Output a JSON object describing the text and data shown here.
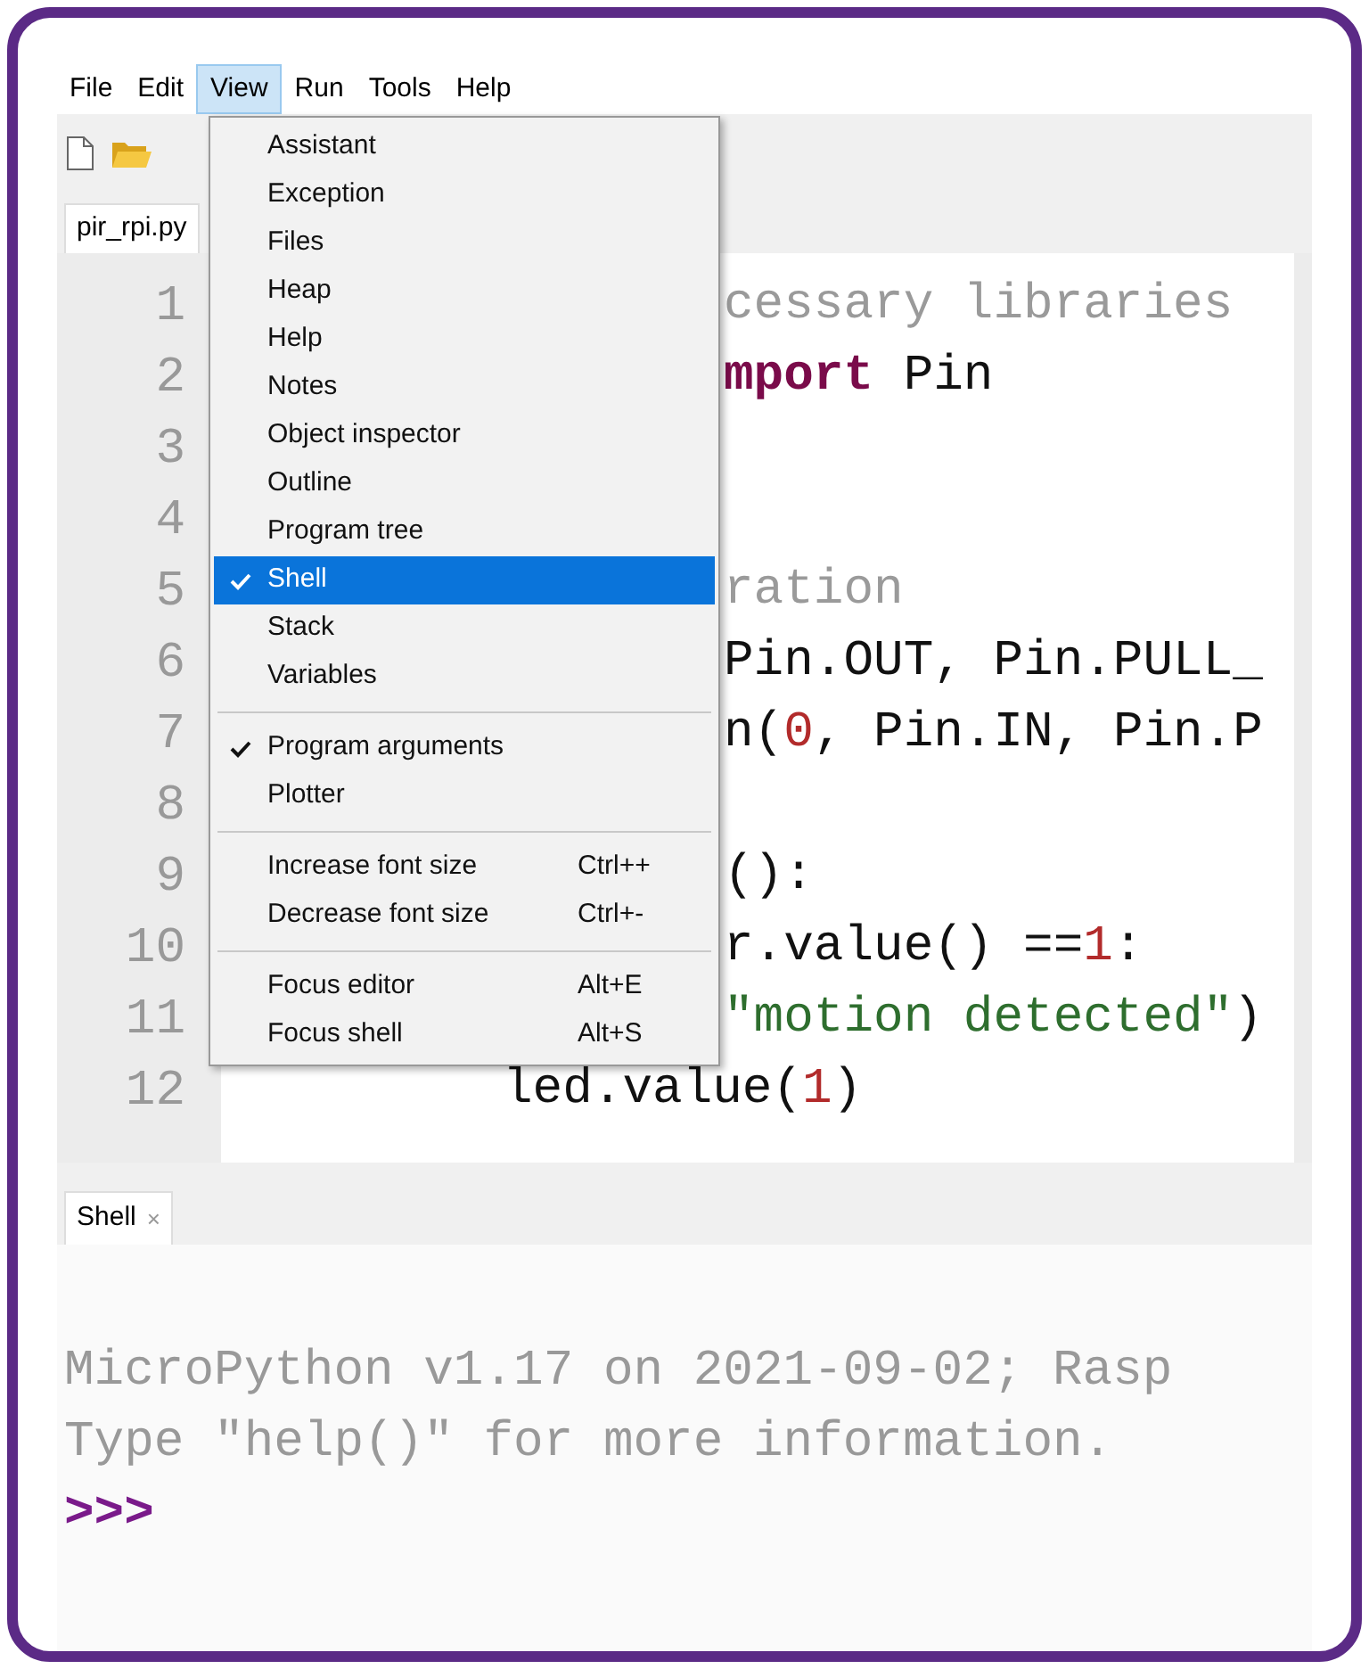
{
  "menubar": [
    {
      "label": "File",
      "selected": false
    },
    {
      "label": "Edit",
      "selected": false
    },
    {
      "label": "View",
      "selected": true
    },
    {
      "label": "Run",
      "selected": false
    },
    {
      "label": "Tools",
      "selected": false
    },
    {
      "label": "Help",
      "selected": false
    }
  ],
  "editor_tab": {
    "label": "pir_rpi.py"
  },
  "view_menu": [
    {
      "kind": "item",
      "label": "Assistant",
      "checked": false,
      "selected": false
    },
    {
      "kind": "item",
      "label": "Exception",
      "checked": false,
      "selected": false
    },
    {
      "kind": "item",
      "label": "Files",
      "checked": false,
      "selected": false
    },
    {
      "kind": "item",
      "label": "Heap",
      "checked": false,
      "selected": false
    },
    {
      "kind": "item",
      "label": "Help",
      "checked": false,
      "selected": false
    },
    {
      "kind": "item",
      "label": "Notes",
      "checked": false,
      "selected": false
    },
    {
      "kind": "item",
      "label": "Object inspector",
      "checked": false,
      "selected": false
    },
    {
      "kind": "item",
      "label": "Outline",
      "checked": false,
      "selected": false
    },
    {
      "kind": "item",
      "label": "Program tree",
      "checked": false,
      "selected": false
    },
    {
      "kind": "item",
      "label": "Shell",
      "checked": true,
      "selected": true
    },
    {
      "kind": "item",
      "label": "Stack",
      "checked": false,
      "selected": false
    },
    {
      "kind": "item",
      "label": "Variables",
      "checked": false,
      "selected": false
    },
    {
      "kind": "separator"
    },
    {
      "kind": "item",
      "label": "Program arguments",
      "checked": true,
      "selected": false
    },
    {
      "kind": "item",
      "label": "Plotter",
      "checked": false,
      "selected": false
    },
    {
      "kind": "separator"
    },
    {
      "kind": "item",
      "label": "Increase font size",
      "shortcut": "Ctrl++",
      "checked": false,
      "selected": false
    },
    {
      "kind": "item",
      "label": "Decrease font size",
      "shortcut": "Ctrl+-",
      "checked": false,
      "selected": false
    },
    {
      "kind": "separator"
    },
    {
      "kind": "item",
      "label": "Focus editor",
      "shortcut": "Alt+E",
      "checked": false,
      "selected": false
    },
    {
      "kind": "item",
      "label": "Focus shell",
      "shortcut": "Alt+S",
      "checked": false,
      "selected": false
    }
  ],
  "code_lines": [
    {
      "number": "1",
      "kind": "partial",
      "segments": [
        {
          "kind": "comment",
          "text": "cessary libraries"
        }
      ]
    },
    {
      "number": "2",
      "kind": "partial",
      "segments": [
        {
          "kind": "keyword",
          "text": "mport"
        },
        {
          "kind": "plain",
          "text": " Pin"
        }
      ]
    },
    {
      "number": "3",
      "kind": "partial"
    },
    {
      "number": "4",
      "kind": "partial"
    },
    {
      "number": "5",
      "kind": "partial",
      "segments": [
        {
          "kind": "comment",
          "text": "ration"
        }
      ]
    },
    {
      "number": "6",
      "kind": "partial",
      "segments": [
        {
          "kind": "plain",
          "text": "Pin.OUT, Pin.PULL_"
        }
      ]
    },
    {
      "number": "7",
      "kind": "partial",
      "segments": [
        {
          "kind": "plain",
          "text": "n("
        },
        {
          "kind": "number",
          "text": "0"
        },
        {
          "kind": "plain",
          "text": ", Pin.IN, Pin.P"
        }
      ]
    },
    {
      "number": "8",
      "kind": "partial"
    },
    {
      "number": "9",
      "kind": "partial",
      "segments": [
        {
          "kind": "plain",
          "text": "():"
        }
      ]
    },
    {
      "number": "10",
      "kind": "partial",
      "segments": [
        {
          "kind": "plain",
          "text": "r.value() =="
        },
        {
          "kind": "number",
          "text": "1"
        },
        {
          "kind": "plain",
          "text": ":"
        }
      ]
    },
    {
      "number": "11",
      "kind": "partial",
      "segments": [
        {
          "kind": "string",
          "text": "\"motion detected\""
        },
        {
          "kind": "plain",
          "text": ")"
        }
      ]
    },
    {
      "number": "12",
      "kind": "indented",
      "segments": [
        {
          "kind": "plain",
          "text": "led.value("
        },
        {
          "kind": "number",
          "text": "1"
        },
        {
          "kind": "plain",
          "text": ")"
        }
      ]
    }
  ],
  "shell": {
    "tab": "Shell",
    "close": "×",
    "output": [
      "MicroPython v1.17 on 2021-09-02; Rasp",
      "Type \"help()\" for more information."
    ],
    "prompt": ">>>"
  }
}
